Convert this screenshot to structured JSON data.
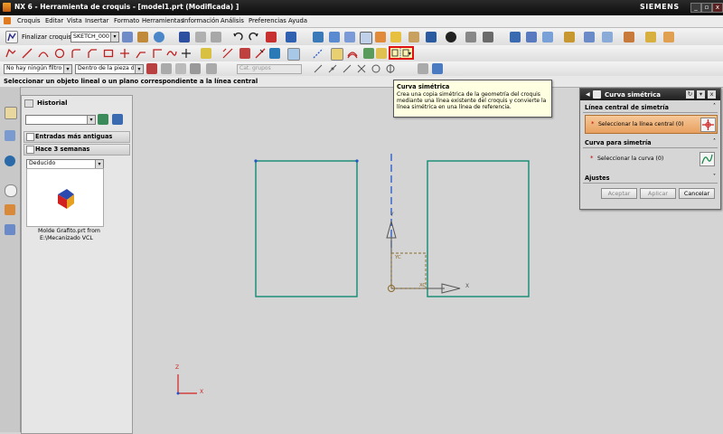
{
  "titlebar": {
    "title": "NX 6 - Herramienta de croquis - [model1.prt (Modificada) ]",
    "brand": "SIEMENS",
    "minimize": "_",
    "restore": "▫",
    "close": "x"
  },
  "menubar": {
    "items": [
      "Croquis",
      "Editar",
      "Vista",
      "Insertar",
      "Formato",
      "Herramientas",
      "Información",
      "Análisis",
      "Preferencias",
      "Ayuda"
    ]
  },
  "sketch_toolbar": {
    "finish_label": "Finalizar croquis",
    "sketch_name": "SKETCH_000"
  },
  "selection_bar": {
    "filter_value": "No hay ningún filtro",
    "scope_value": "Dentro de la pieza de",
    "layer_placeholder": "Cat. grupos"
  },
  "cue_line": "Seleccionar un objeto lineal o un plano correspondiente a la línea central",
  "resource_nav": {
    "history_title": "Historial",
    "group_old": "Entradas más antiguas",
    "group_recent": "Hace 3 semanas",
    "deduced_value": "Deducido",
    "file_label_line1": "Molde Grafito.prt from",
    "file_label_line2": "E:\\Mecanizado VCL"
  },
  "tooltip": {
    "title": "Curva simétrica",
    "body": "Crea una copia simétrica de la geometría del croquis mediante una línea existente del croquis y convierte la línea simétrica en una línea de referencia."
  },
  "dialog": {
    "title": "Curva simétrica",
    "section_centerline": "Línea central de simetría",
    "select_centerline": "Seleccionar la línea central (0)",
    "section_curve": "Curva para simetría",
    "select_curve": "Seleccionar la curva (0)",
    "section_settings": "Ajustes",
    "accept": "Aceptar",
    "apply": "Aplicar",
    "cancel": "Cancelar"
  },
  "canvas": {
    "axis_x": "X",
    "axis_y": "Y",
    "axis_z": "Z",
    "sketch_x": "XC",
    "sketch_y": "YC"
  },
  "colors": {
    "geometry": "#138a72",
    "centerline": "#2456c9",
    "highlight": "#e01010",
    "axes": "#d02020"
  }
}
